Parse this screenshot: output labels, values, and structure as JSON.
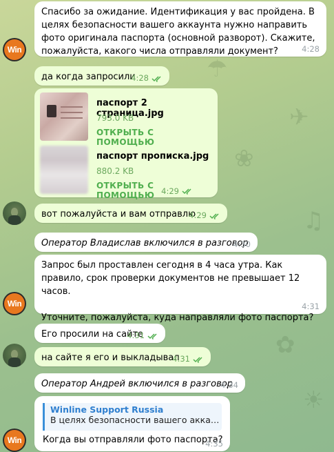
{
  "messages": {
    "m1": {
      "text": "Спасибо за ожидание. Идентификация у вас пройдена. В целях безопасности вашего аккаунта нужно направить фото оригинала паспорта (основной разворот). Скажите, пожалуйста, какого числа отправляли документ?",
      "time": "4:28"
    },
    "m2": {
      "text": "да когда запросили",
      "time": "4:28"
    },
    "m3": {
      "files": [
        {
          "name": "паспорт 2 страница.jpg",
          "size": "793.0 KB",
          "open": "ОТКРЫТЬ С ПОМОЩЬЮ"
        },
        {
          "name": "паспорт прописка.jpg",
          "size": "880.2 KB",
          "open": "ОТКРЫТЬ С ПОМОЩЬЮ"
        }
      ],
      "time": "4:29"
    },
    "m4": {
      "text": "вот пожалуйста и вам отправлю",
      "time": "4:29"
    },
    "m5": {
      "text": "Оператор Владислав включился в разговор",
      "time": "4:30"
    },
    "m6": {
      "text": "Запрос был проставлен сегодня в 4 часа утра. Как правило, срок проверки документов не превышает 12 часов.\n\nУточните, пожалуйста, куда направляли фото паспорта?",
      "time": "4:31"
    },
    "m7": {
      "text": "Его просили на сайте",
      "time": "4:31"
    },
    "m8": {
      "text": "на сайте я его и выкладывал",
      "time": "4:31"
    },
    "m9": {
      "text": "Оператор Андрей включился в разговор",
      "time": "4:34"
    },
    "m10": {
      "reply_name": "Winline Support Russia",
      "reply_text": "В целях безопасности вашего аккаунта ...",
      "text": "Когда вы отправляли фото паспорта?",
      "time": "4:35"
    }
  },
  "avatars": {
    "support_label": "Win"
  },
  "colors": {
    "outgoing": "#eefed7",
    "accent_green": "#4fae4e",
    "link_blue": "#2f7fcf"
  }
}
